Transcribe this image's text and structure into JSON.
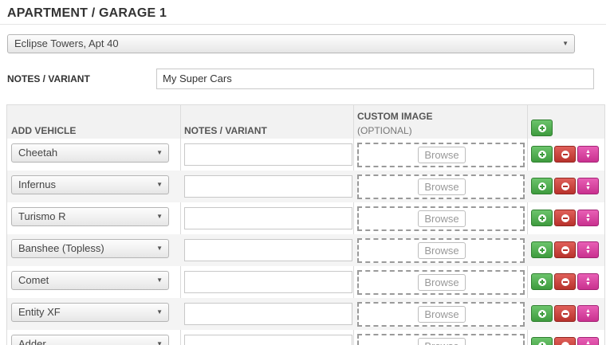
{
  "page": {
    "title": "APARTMENT / GARAGE 1"
  },
  "location": {
    "selected": "Eclipse Towers, Apt 40"
  },
  "notes": {
    "label": "NOTES / VARIANT",
    "value": "My Super Cars"
  },
  "table": {
    "headers": {
      "vehicle": "ADD VEHICLE",
      "notes": "NOTES / VARIANT",
      "image": "CUSTOM IMAGE",
      "image_sub": "(OPTIONAL)"
    },
    "browse_label": "Browse",
    "rows": [
      {
        "vehicle": "Cheetah",
        "notes": ""
      },
      {
        "vehicle": "Infernus",
        "notes": ""
      },
      {
        "vehicle": "Turismo R",
        "notes": ""
      },
      {
        "vehicle": "Banshee (Topless)",
        "notes": ""
      },
      {
        "vehicle": "Comet",
        "notes": ""
      },
      {
        "vehicle": "Entity XF",
        "notes": ""
      },
      {
        "vehicle": "Adder",
        "notes": ""
      }
    ]
  },
  "icons": {
    "add": "plus-circle-icon",
    "remove": "minus-circle-icon",
    "move": "up-down-arrows-icon",
    "dropdown": "caret-down-icon"
  },
  "colors": {
    "add": "#4cae4c",
    "remove": "#c9302c",
    "move": "#d6399e"
  }
}
